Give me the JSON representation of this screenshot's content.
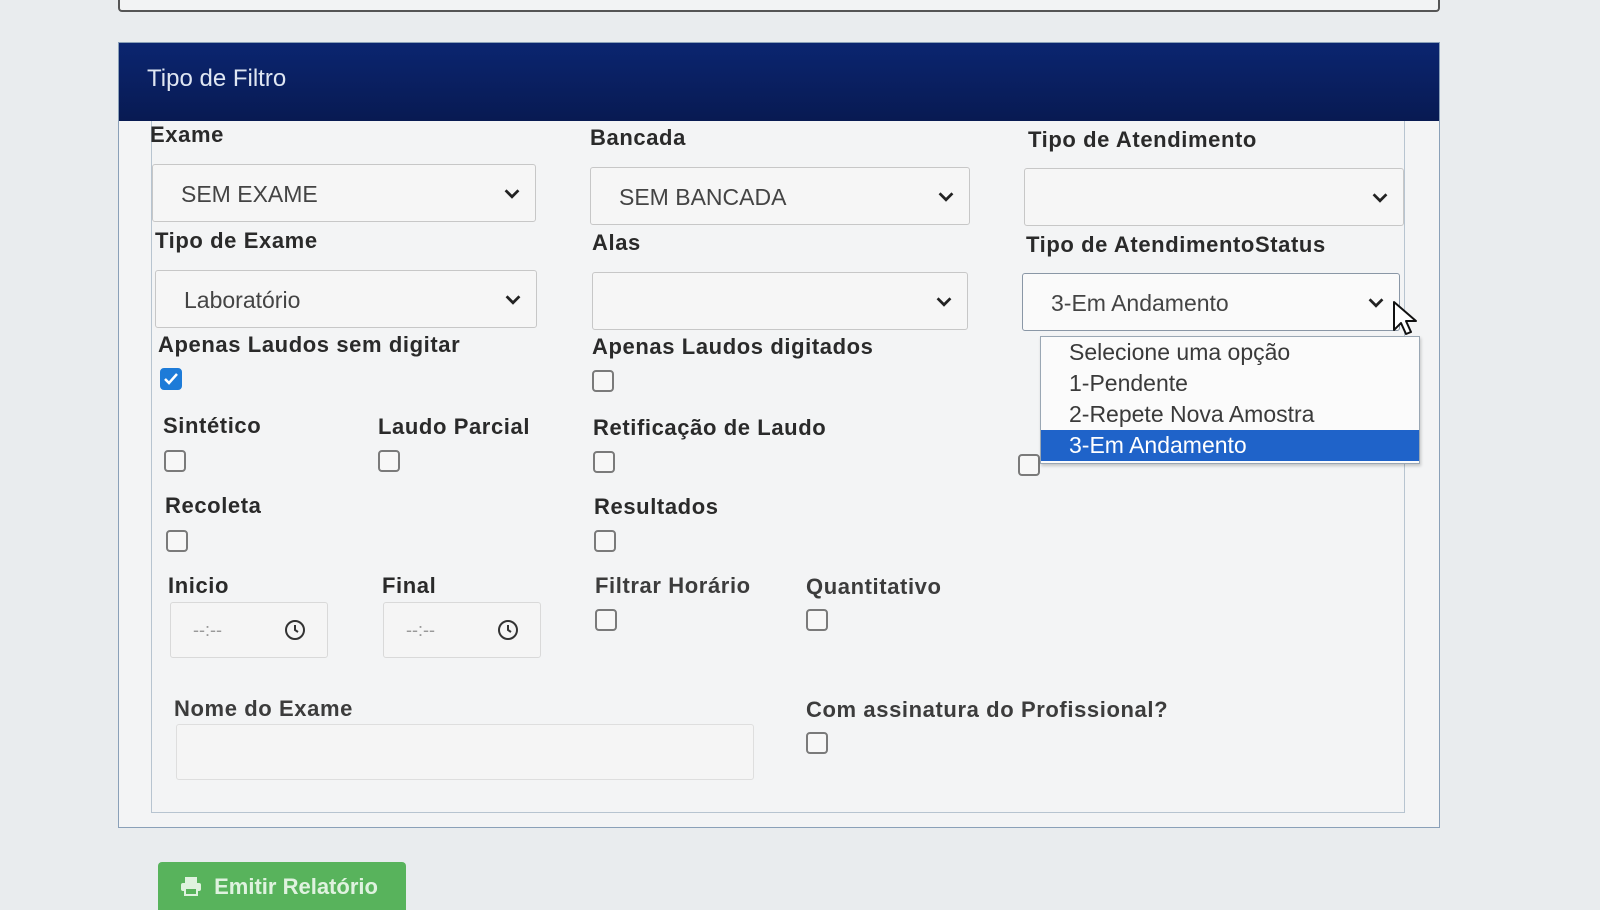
{
  "panel": {
    "title": "Tipo de Filtro"
  },
  "fields": {
    "exame": {
      "label": "Exame",
      "value": "SEM EXAME"
    },
    "bancada": {
      "label": "Bancada",
      "value": "SEM BANCADA"
    },
    "tipo_atendimento": {
      "label": "Tipo de Atendimento",
      "value": ""
    },
    "tipo_exame": {
      "label": "Tipo de Exame",
      "value": "Laboratório"
    },
    "alas": {
      "label": "Alas",
      "value": ""
    },
    "tipo_atendimento_status": {
      "label": "Tipo de AtendimentoStatus",
      "value": "3-Em Andamento",
      "options": [
        "Selecione uma opção",
        "1-Pendente",
        "2-Repete Nova Amostra",
        "3-Em Andamento"
      ],
      "selected_index": 3
    }
  },
  "checkboxes": {
    "apenas_laudos_sem_digitar": {
      "label": "Apenas Laudos sem digitar",
      "checked": true
    },
    "apenas_laudos_digitados": {
      "label": "Apenas Laudos digitados",
      "checked": false
    },
    "sintetico": {
      "label": "Sintético",
      "checked": false
    },
    "laudo_parcial": {
      "label": "Laudo Parcial",
      "checked": false
    },
    "retificacao_laudo": {
      "label": "Retificação de Laudo",
      "checked": false
    },
    "recoleta": {
      "label": "Recoleta",
      "checked": false
    },
    "resultados": {
      "label": "Resultados",
      "checked": false
    },
    "filtrar_horario": {
      "label": "Filtrar Horário",
      "checked": false
    },
    "quantitativo": {
      "label": "Quantitativo",
      "checked": false
    },
    "assinatura_profissional": {
      "label": "Com assinatura do Profissional?",
      "checked": false
    }
  },
  "time": {
    "inicio": {
      "label": "Inicio",
      "placeholder": "--:--"
    },
    "final": {
      "label": "Final",
      "placeholder": "--:--"
    }
  },
  "nome_exame": {
    "label": "Nome do Exame",
    "value": ""
  },
  "buttons": {
    "emitir": "Emitir Relatório"
  },
  "colors": {
    "header": "#0b2570",
    "selected_option": "#1f63c9",
    "checkbox_checked": "#1d7bd8",
    "emit_button": "#58b35c"
  }
}
